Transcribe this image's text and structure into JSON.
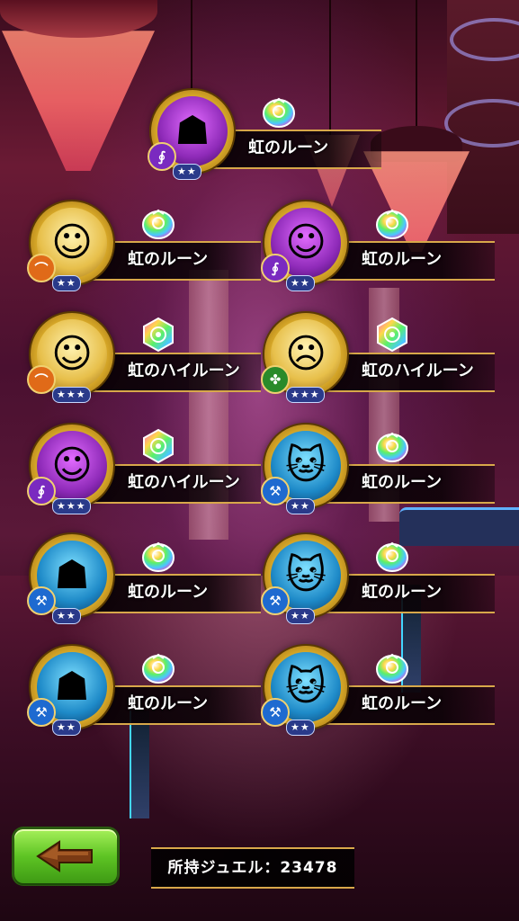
{
  "rewards": [
    {
      "name": "虹のルーン",
      "rune_type": "rune",
      "unit_icon": "dark-knight-portrait-icon",
      "class_icon": "staff-icon",
      "stars": 2,
      "frame": "purple"
    },
    {
      "name": "虹のルーン",
      "rune_type": "rune",
      "unit_icon": "green-haired-archer-portrait-icon",
      "class_icon": "bow-icon",
      "stars": 2,
      "frame": "gold"
    },
    {
      "name": "虹のルーン",
      "rune_type": "rune",
      "unit_icon": "blonde-elf-mage-portrait-icon",
      "class_icon": "staff-icon",
      "stars": 2,
      "frame": "purple"
    },
    {
      "name": "虹のハイルーン",
      "rune_type": "high-rune",
      "unit_icon": "orange-haired-archer-portrait-icon",
      "class_icon": "bow-icon",
      "stars": 3,
      "frame": "gold"
    },
    {
      "name": "虹のハイルーン",
      "rune_type": "high-rune",
      "unit_icon": "old-sage-portrait-icon",
      "class_icon": "healer-icon",
      "stars": 3,
      "frame": "gold"
    },
    {
      "name": "虹のハイルーン",
      "rune_type": "high-rune",
      "unit_icon": "pirate-mage-portrait-icon",
      "class_icon": "staff-icon",
      "stars": 3,
      "frame": "purple"
    },
    {
      "name": "虹のルーン",
      "rune_type": "rune",
      "unit_icon": "silver-cat-portrait-icon",
      "class_icon": "axe-icon",
      "stars": 2,
      "frame": "blue"
    },
    {
      "name": "虹のルーン",
      "rune_type": "rune",
      "unit_icon": "dark-knight-portrait-icon",
      "class_icon": "axe-icon",
      "stars": 2,
      "frame": "blue"
    },
    {
      "name": "虹のルーン",
      "rune_type": "rune",
      "unit_icon": "silver-cat-portrait-icon",
      "class_icon": "axe-icon",
      "stars": 2,
      "frame": "blue"
    },
    {
      "name": "虹のルーン",
      "rune_type": "rune",
      "unit_icon": "dark-knight-portrait-icon",
      "class_icon": "axe-icon",
      "stars": 2,
      "frame": "blue"
    },
    {
      "name": "虹のルーン",
      "rune_type": "rune",
      "unit_icon": "silver-cat-portrait-icon",
      "class_icon": "axe-icon",
      "stars": 2,
      "frame": "blue"
    }
  ],
  "footer": {
    "back_icon": "back-arrow-icon",
    "jewels_text": "所持ジュエル：23478"
  },
  "colors": {
    "accent_gold": "#d8a84a",
    "back_button_green": "#5ec424"
  }
}
